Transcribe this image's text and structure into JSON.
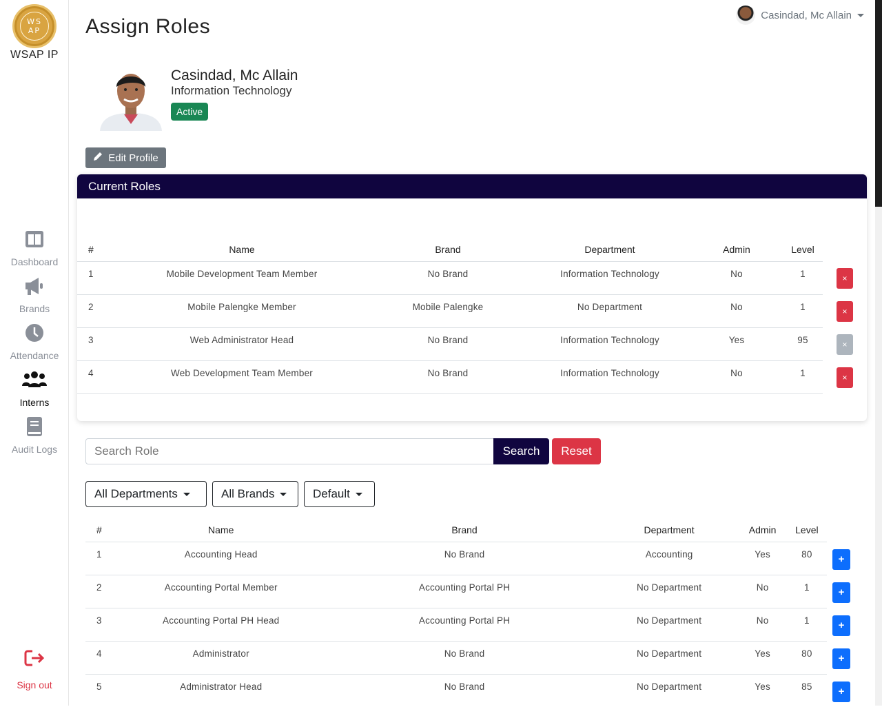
{
  "sidebar": {
    "logo_text_1": "WS",
    "logo_text_2": "AP",
    "brand": "WSAP IP",
    "items": [
      {
        "label": "Dashboard",
        "icon": "dashboard-icon"
      },
      {
        "label": "Brands",
        "icon": "megaphone-icon"
      },
      {
        "label": "Attendance",
        "icon": "clock-icon"
      },
      {
        "label": "Interns",
        "icon": "users-icon",
        "active": true
      },
      {
        "label": "Audit Logs",
        "icon": "book-icon"
      }
    ],
    "signout": "Sign out"
  },
  "header": {
    "user_name": "Casindad, Mc Allain",
    "page_title": "Assign Roles"
  },
  "profile": {
    "name": "Casindad, Mc Allain",
    "department": "Information Technology",
    "status": "Active",
    "edit_label": "Edit Profile"
  },
  "current_roles": {
    "title": "Current Roles",
    "columns": {
      "num": "#",
      "name": "Name",
      "brand": "Brand",
      "department": "Department",
      "admin": "Admin",
      "level": "Level"
    },
    "rows": [
      {
        "num": "1",
        "name": "Mobile Development Team Member",
        "brand": "No Brand",
        "department": "Information Technology",
        "admin": "No",
        "level": "1",
        "removable": true
      },
      {
        "num": "2",
        "name": "Mobile Palengke Member",
        "brand": "Mobile Palengke",
        "department": "No Department",
        "admin": "No",
        "level": "1",
        "removable": true
      },
      {
        "num": "3",
        "name": "Web Administrator Head",
        "brand": "No Brand",
        "department": "Information Technology",
        "admin": "Yes",
        "level": "95",
        "removable": false
      },
      {
        "num": "4",
        "name": "Web Development Team Member",
        "brand": "No Brand",
        "department": "Information Technology",
        "admin": "No",
        "level": "1",
        "removable": true
      }
    ],
    "remove_glyph": "×"
  },
  "search": {
    "placeholder": "Search Role",
    "search_label": "Search",
    "reset_label": "Reset"
  },
  "filters": {
    "department": "All Departments",
    "brand": "All Brands",
    "sort": "Default"
  },
  "roles": {
    "columns": {
      "num": "#",
      "name": "Name",
      "brand": "Brand",
      "department": "Department",
      "admin": "Admin",
      "level": "Level"
    },
    "rows": [
      {
        "num": "1",
        "name": "Accounting Head",
        "brand": "No Brand",
        "department": "Accounting",
        "admin": "Yes",
        "level": "80"
      },
      {
        "num": "2",
        "name": "Accounting Portal Member",
        "brand": "Accounting Portal PH",
        "department": "No Department",
        "admin": "No",
        "level": "1"
      },
      {
        "num": "3",
        "name": "Accounting Portal PH Head",
        "brand": "Accounting Portal PH",
        "department": "No Department",
        "admin": "No",
        "level": "1"
      },
      {
        "num": "4",
        "name": "Administrator",
        "brand": "No Brand",
        "department": "No Department",
        "admin": "Yes",
        "level": "80"
      },
      {
        "num": "5",
        "name": "Administrator Head",
        "brand": "No Brand",
        "department": "No Department",
        "admin": "Yes",
        "level": "85"
      }
    ],
    "add_glyph": "+"
  },
  "colors": {
    "primary_dark": "#10053f",
    "danger": "#dc3545",
    "success": "#198754",
    "info": "#0d6efd",
    "secondary": "#6c757d"
  }
}
